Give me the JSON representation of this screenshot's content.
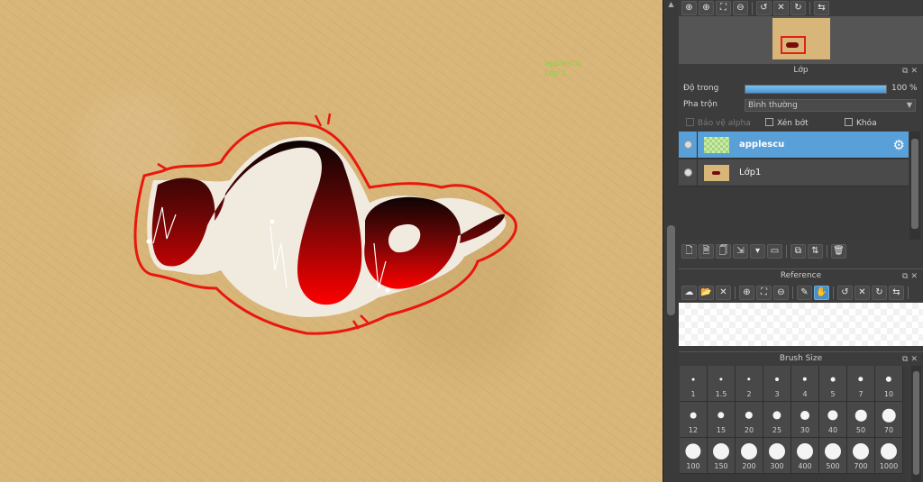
{
  "canvas": {
    "overlay_text_line1": "applescu",
    "overlay_text_line2": "Lớp 1"
  },
  "top_toolbar": {
    "icons": [
      "zoom-in-icon",
      "zoom-icon",
      "fit-icon",
      "zoom-out-icon",
      "rotate-left-icon",
      "reset-icon",
      "rotate-right-icon",
      "flip-icon"
    ],
    "glyphs": [
      "⊕",
      "⊕",
      "⛶",
      "⊖",
      "↺",
      "✕",
      "↻",
      "⇆"
    ]
  },
  "layer_panel": {
    "title": "Lớp",
    "opacity_label": "Độ trong",
    "opacity_value": "100 %",
    "opacity_fraction": 1.0,
    "blend_label": "Pha trộn",
    "blend_value": "Bình thường",
    "protect_alpha_label": "Bảo vệ alpha",
    "clipping_label": "Xén bớt",
    "lock_label": "Khóa",
    "layers": [
      {
        "name": "applescu",
        "selected": true
      },
      {
        "name": "Lớp1",
        "selected": false
      }
    ]
  },
  "layer_toolbar": {
    "glyphs": [
      "🗋",
      "🗎",
      "🗍",
      "⇲",
      "▾",
      "▭",
      "⧉",
      "⇅",
      "🗑"
    ]
  },
  "reference_panel": {
    "title": "Reference",
    "glyphs": [
      "☁",
      "📂",
      "✕",
      "⊕",
      "⛶",
      "⊖",
      "✎",
      "✋",
      "↺",
      "✕",
      "↻",
      "⇆"
    ]
  },
  "brush_size_panel": {
    "title": "Brush Size",
    "sizes": [
      "1",
      "1.5",
      "2",
      "3",
      "4",
      "5",
      "7",
      "10",
      "12",
      "15",
      "20",
      "25",
      "30",
      "40",
      "50",
      "70",
      "100",
      "150",
      "200",
      "300",
      "400",
      "500",
      "700",
      "1000"
    ]
  },
  "colors": {
    "accent": "#5aa0d8",
    "canvas_paper": "#d8b578",
    "ink_dark": "#1a0505",
    "ink_red": "#e00000",
    "outline_red": "#e8180f"
  }
}
